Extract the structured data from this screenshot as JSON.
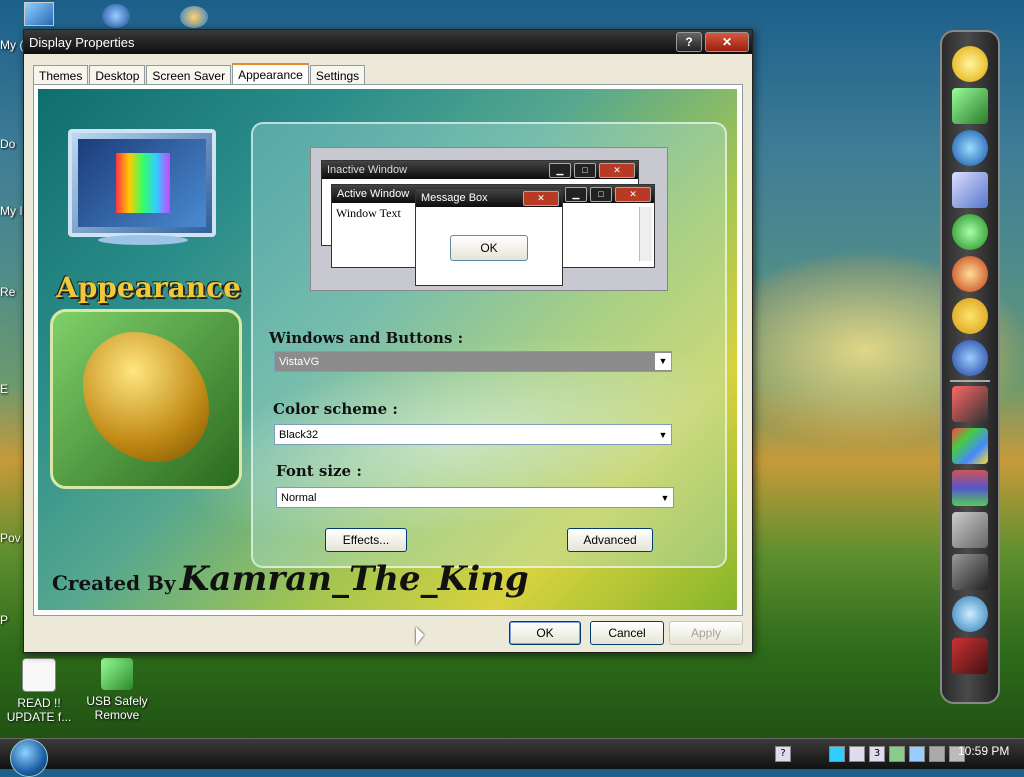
{
  "desktop": {
    "icons": [
      {
        "label": "READ !! UPDATE f..."
      },
      {
        "label": "USB Safely Remove"
      }
    ],
    "edge_labels": [
      "My (",
      "Do",
      "My I",
      "Re",
      "E",
      "Pov",
      "P"
    ]
  },
  "window": {
    "title": "Display Properties",
    "controls": {
      "help": "?",
      "close": "✕"
    },
    "tabs": [
      "Themes",
      "Desktop",
      "Screen Saver",
      "Appearance",
      "Settings"
    ],
    "active_tab": "Appearance"
  },
  "art": {
    "heading": "Appearance",
    "credit_prefix": "Created By",
    "credit_name": "Kamran_The_King"
  },
  "preview": {
    "inactive_title": "Inactive Window",
    "active_title": "Active Window",
    "message_title": "Message Box",
    "window_text": "Window Text",
    "ok_label": "OK",
    "min_glyph": "▁",
    "max_glyph": "□",
    "close_glyph": "✕"
  },
  "form": {
    "windows_buttons_label": "Windows and Buttons :",
    "windows_buttons_value": "VistaVG",
    "color_scheme_label": "Color scheme :",
    "color_scheme_value": "Black32",
    "font_size_label": "Font size :",
    "font_size_value": "Normal",
    "effects_button": "Effects...",
    "advanced_button": "Advanced",
    "dropdown_arrow": "▼"
  },
  "dialog_buttons": {
    "ok": "OK",
    "cancel": "Cancel",
    "apply": "Apply"
  },
  "taskbar": {
    "clock": "10:59 PM",
    "tray": [
      "?",
      "3"
    ]
  },
  "colors": {
    "title_bar": "#0e0e0e",
    "close_red": "#b83a24",
    "tab_highlight": "#e68b2c",
    "accent_gold": "#f0c93a"
  }
}
